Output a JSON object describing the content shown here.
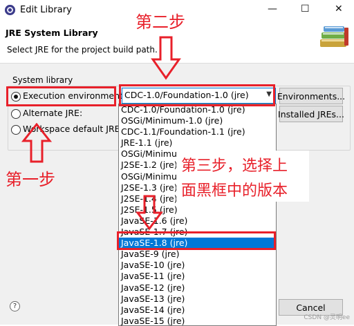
{
  "window": {
    "title": "Edit Library",
    "minimize": "—",
    "maximize": "☐",
    "close": "✕"
  },
  "header": {
    "title": "JRE System Library",
    "subtitle": "Select JRE for the project build path."
  },
  "group": {
    "label": "System library"
  },
  "options": {
    "execution_env": "Execution environment:",
    "alternate_jre": "Alternate JRE:",
    "workspace_default": "Workspace default JRE (j"
  },
  "combo": {
    "value": "CDC-1.0/Foundation-1.0 (jre)"
  },
  "buttons": {
    "environments": "Environments...",
    "installed_jres": "Installed JREs...",
    "cancel": "Cancel"
  },
  "dropdown": {
    "items": [
      "CDC-1.0/Foundation-1.0 (jre)",
      "OSGi/Minimum-1.0 (jre)",
      "CDC-1.1/Foundation-1.1 (jre)",
      "JRE-1.1 (jre)",
      "OSGi/Minimum",
      "J2SE-1.2 (jre)",
      "OSGi/Minimum",
      "J2SE-1.3 (jre)",
      "J2SE-1.4 (jre)",
      "J2SE-1.5 (jre)",
      "JavaSE-1.6 (jre)",
      "JavaSE-1.7 (jre)",
      "JavaSE-1.8 (jre)",
      "JavaSE-9 (jre)",
      "JavaSE-10 (jre)",
      "JavaSE-11 (jre)",
      "JavaSE-12 (jre)",
      "JavaSE-13 (jre)",
      "JavaSE-14 (jre)",
      "JavaSE-15 (jre)"
    ],
    "selected_index": 12
  },
  "annotations": {
    "step1": "第一步",
    "step2": "第二步",
    "step3_line1": "第三步，选择上",
    "step3_line2": "面黑框中的版本"
  },
  "watermark": "CSDN @灵明ee",
  "colors": {
    "annotation_red": "#e8202a",
    "selection_blue": "#0078d7"
  }
}
